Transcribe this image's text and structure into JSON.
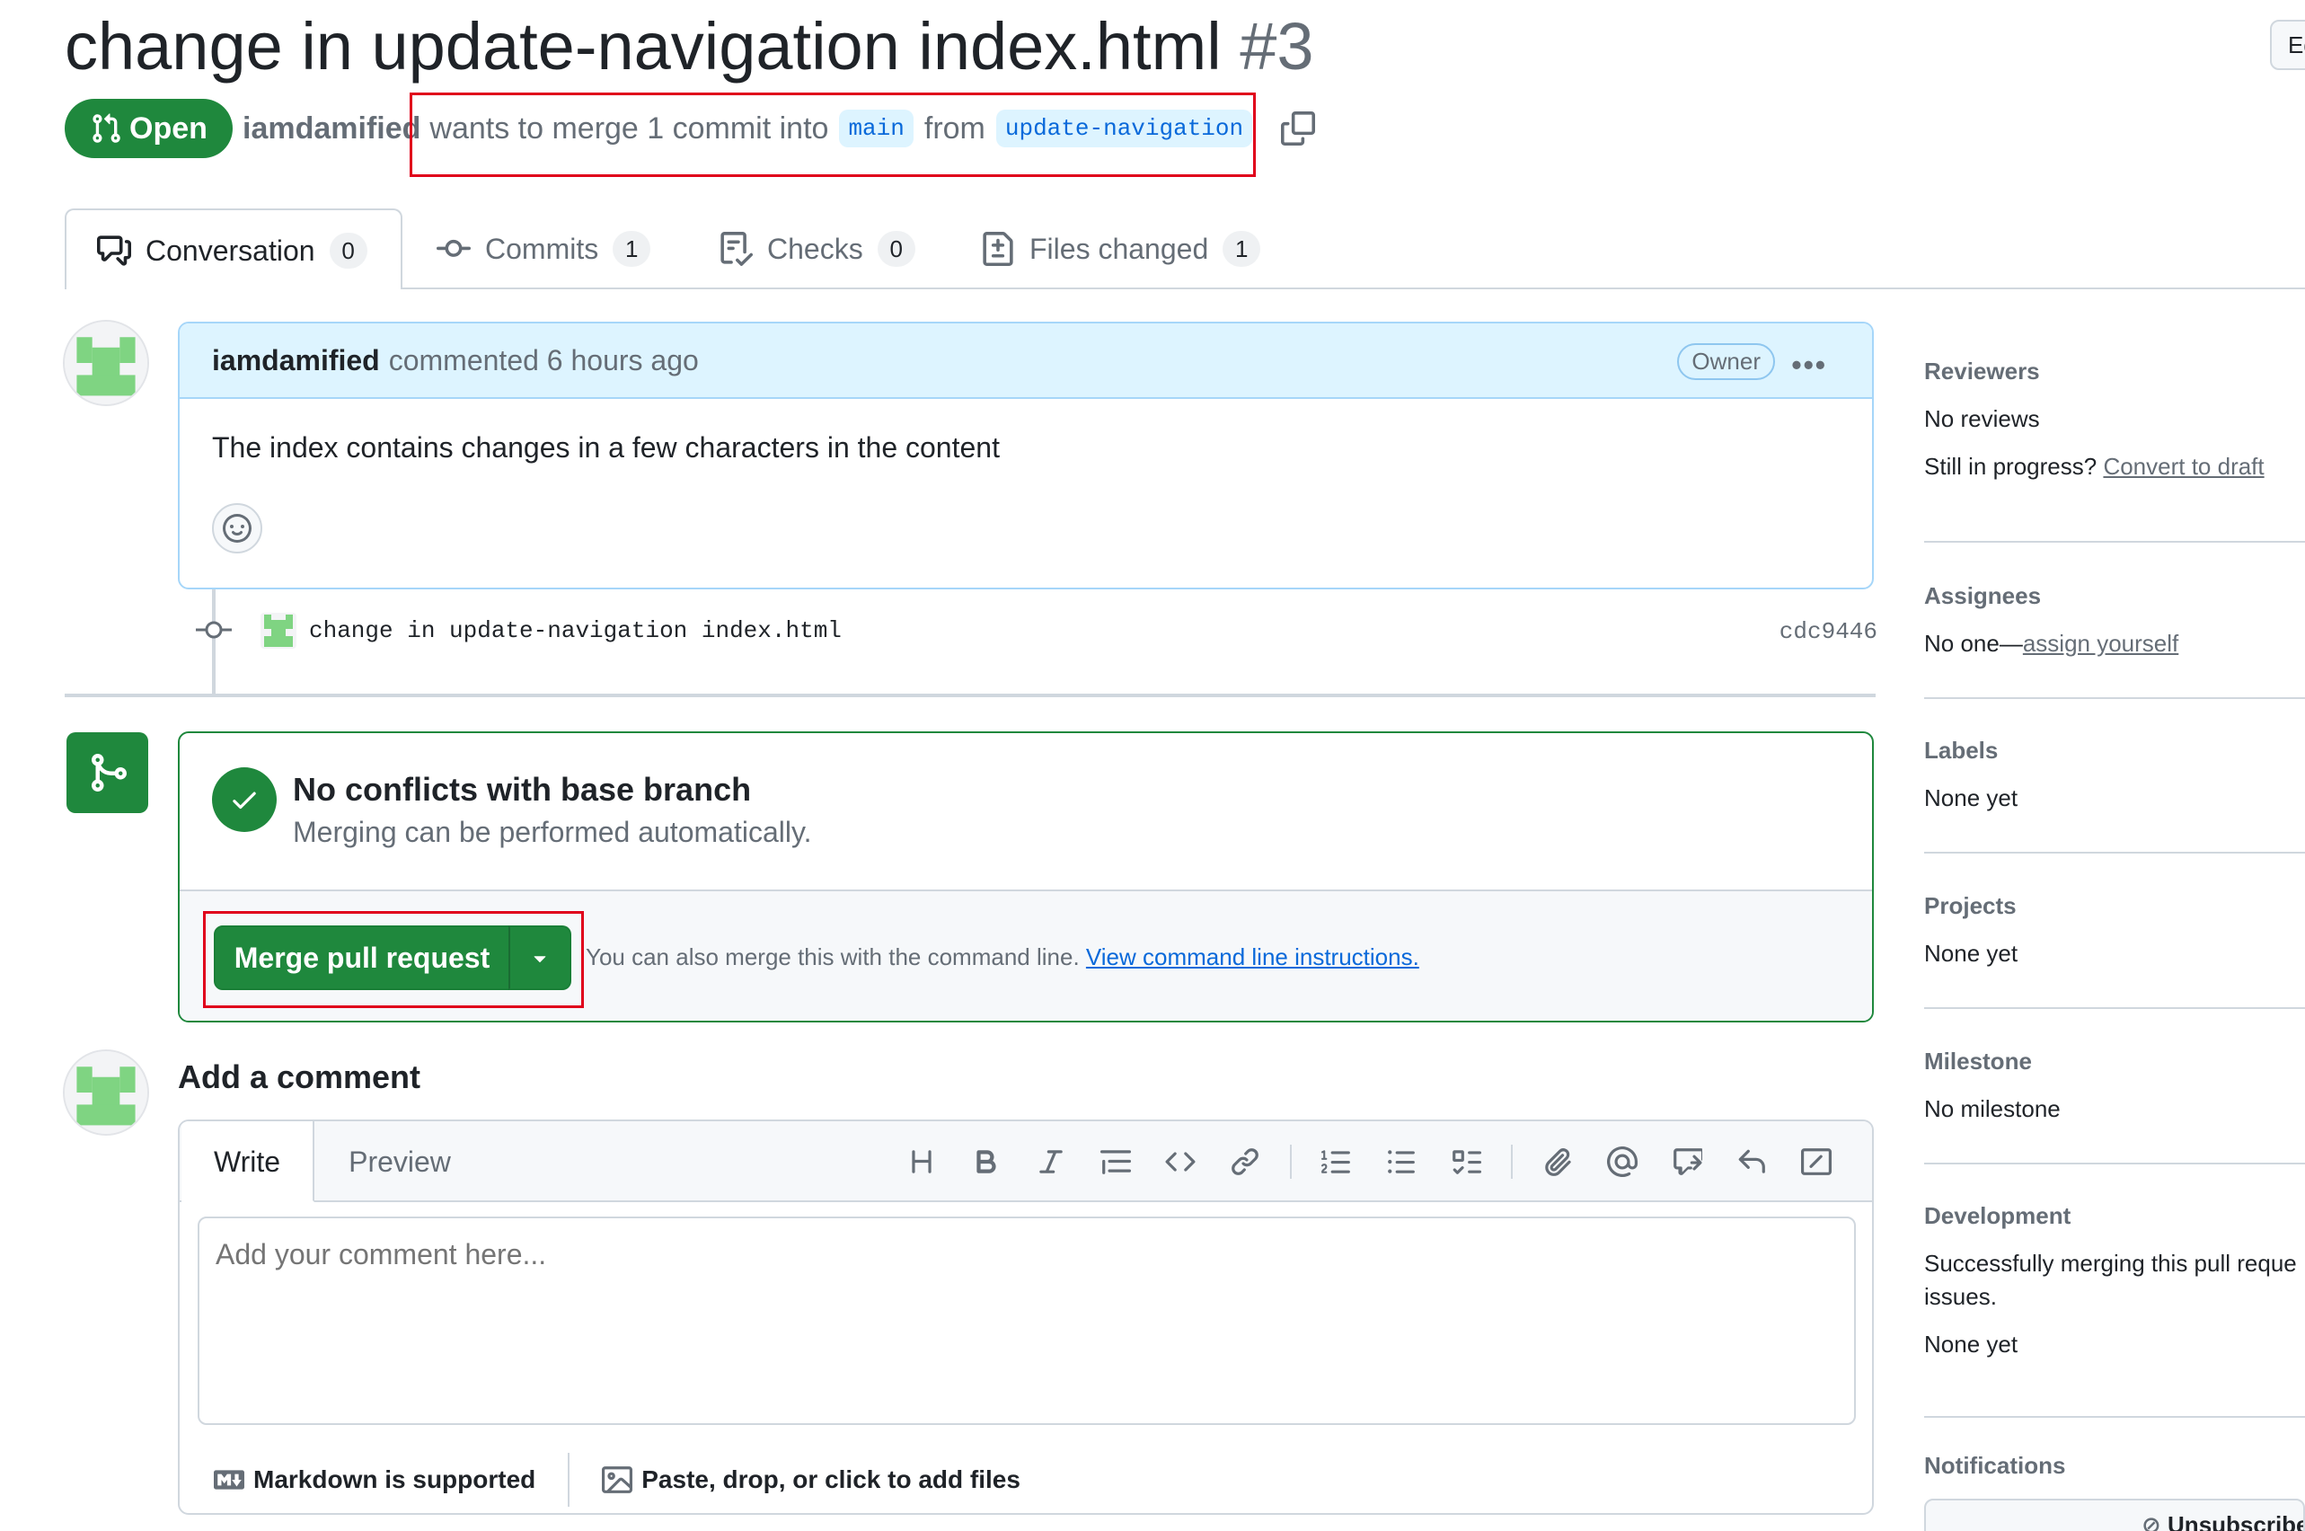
{
  "pr": {
    "title": "change in update-navigation index.html",
    "number": "#3",
    "edit_label": "Ed",
    "state": "Open",
    "author": "iamdamified",
    "merge_text_1": "wants to merge 1 commit into",
    "base_branch": "main",
    "merge_text_2": "from",
    "head_branch": "update-navigation"
  },
  "tabs": [
    {
      "label": "Conversation",
      "count": "0"
    },
    {
      "label": "Commits",
      "count": "1"
    },
    {
      "label": "Checks",
      "count": "0"
    },
    {
      "label": "Files changed",
      "count": "1"
    }
  ],
  "comment": {
    "author": "iamdamified",
    "action": "commented 6 hours ago",
    "role_badge": "Owner",
    "body": "The index contains changes in a few characters in the content"
  },
  "commit": {
    "message": "change in update-navigation index.html",
    "sha": "cdc9446"
  },
  "merge": {
    "heading": "No conflicts with base branch",
    "subtext": "Merging can be performed automatically.",
    "button_label": "Merge pull request",
    "cli_text": "You can also merge this with the command line.",
    "cli_link": "View command line instructions."
  },
  "editor": {
    "title": "Add a comment",
    "tab_write": "Write",
    "tab_preview": "Preview",
    "placeholder": "Add your comment here...",
    "markdown_note": "Markdown is supported",
    "attach_note": "Paste, drop, or click to add files",
    "toolbar_icons": [
      "heading-icon",
      "bold-icon",
      "italic-icon",
      "quote-icon",
      "code-icon",
      "link-icon",
      "ordered-list-icon",
      "unordered-list-icon",
      "task-list-icon",
      "attach-icon",
      "mention-icon",
      "cross-reference-icon",
      "reply-icon",
      "slash-command-icon"
    ]
  },
  "sidebar": {
    "reviewers": {
      "heading": "Reviewers",
      "value": "No reviews",
      "draft_prefix": "Still in progress?",
      "draft_link": "Convert to draft"
    },
    "assignees": {
      "heading": "Assignees",
      "value_prefix": "No one—",
      "value_link": "assign yourself"
    },
    "labels": {
      "heading": "Labels",
      "value": "None yet"
    },
    "projects": {
      "heading": "Projects",
      "value": "None yet"
    },
    "milestone": {
      "heading": "Milestone",
      "value": "No milestone"
    },
    "development": {
      "heading": "Development",
      "text_1": "Successfully merging this pull reque",
      "text_2": "issues.",
      "value": "None yet"
    },
    "notifications": {
      "heading": "Notifications",
      "button": "Unsubscribe"
    }
  },
  "colors": {
    "primary_green": "#1f883d",
    "link_blue": "#0969da",
    "branch_bg": "#ddf4ff",
    "highlight_red": "#e0001b",
    "comment_header_bg": "#ddf4ff"
  }
}
